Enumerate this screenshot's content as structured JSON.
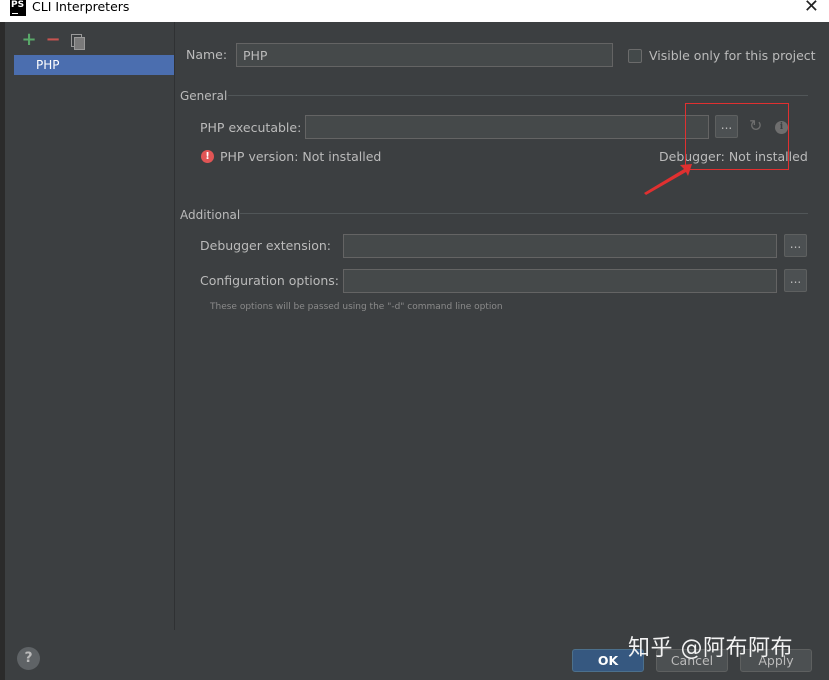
{
  "window": {
    "app_icon_text": "PS",
    "title": "CLI Interpreters",
    "close_glyph": "✕"
  },
  "sidebar": {
    "toolbar": {
      "add_glyph": "+",
      "remove_glyph": "−",
      "copy_icon": "copy-icon"
    },
    "items": [
      {
        "label": "PHP",
        "selected": true
      }
    ]
  },
  "name_row": {
    "label": "Name:",
    "value": "PHP",
    "visible_only_label": "Visible only for this project",
    "visible_only_checked": false
  },
  "general": {
    "section_title": "General",
    "php_executable_label": "PHP executable:",
    "php_executable_value": "",
    "browse_label": "...",
    "php_version_text": "PHP version: Not installed",
    "debugger_text": "Debugger: Not installed"
  },
  "additional": {
    "section_title": "Additional",
    "debugger_extension_label": "Debugger extension:",
    "debugger_extension_value": "",
    "configuration_options_label": "Configuration options:",
    "configuration_options_value": "",
    "browse_label": "...",
    "hint": "These options will be passed using the \"-d\" command line option"
  },
  "footer": {
    "help_label": "?",
    "ok_label": "OK",
    "cancel_label": "Cancel",
    "apply_label": "Apply"
  },
  "watermark": "知乎 @阿布阿布",
  "colors": {
    "background": "#3c3f41",
    "selection": "#4b6eaf",
    "ok_button": "#365880",
    "error": "#e05555",
    "annotation": "#e03030"
  }
}
